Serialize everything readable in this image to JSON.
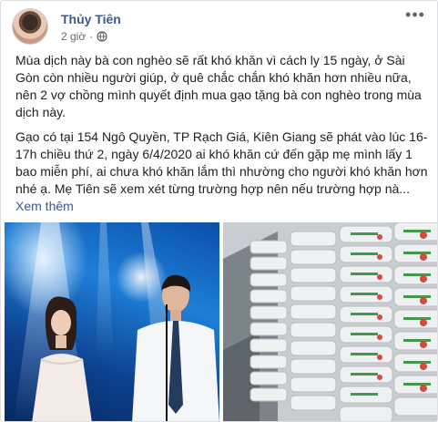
{
  "post": {
    "author": "Thủy Tiên",
    "time": "2 giờ",
    "separator": "·",
    "privacy_icon": "globe-icon",
    "more_icon": "more-options-icon",
    "paragraph1": "Mùa dịch này bà con nghèo sẽ rất khó khăn vì cách ly 15 ngày, ở Sài Gòn còn nhiều người giúp, ở quê chắc chắn khó khăn hơn nhiều nữa, nên 2 vợ chồng mình quyết định mua gạo tặng bà con nghèo trong mùa dịch này.",
    "paragraph2": "Gạo có tại 154 Ngô Quyền, TP Rạch Giá, Kiên Giang sẽ phát vào lúc 16-17h chiều thứ 2, ngày 6/4/2020 ai khó khăn cứ đến gặp mẹ mình lấy 1 bao miễn phí, ai chưa khó khăn lắm thì nhường cho người khó khăn hơn nhé ạ. Mẹ Tiên sẽ xem xét từng trường hợp nên nếu trường hợp nà...",
    "see_more": "Xem thêm"
  },
  "colors": {
    "link": "#385898",
    "secondary_text": "#616770",
    "border": "#dddfe2"
  }
}
